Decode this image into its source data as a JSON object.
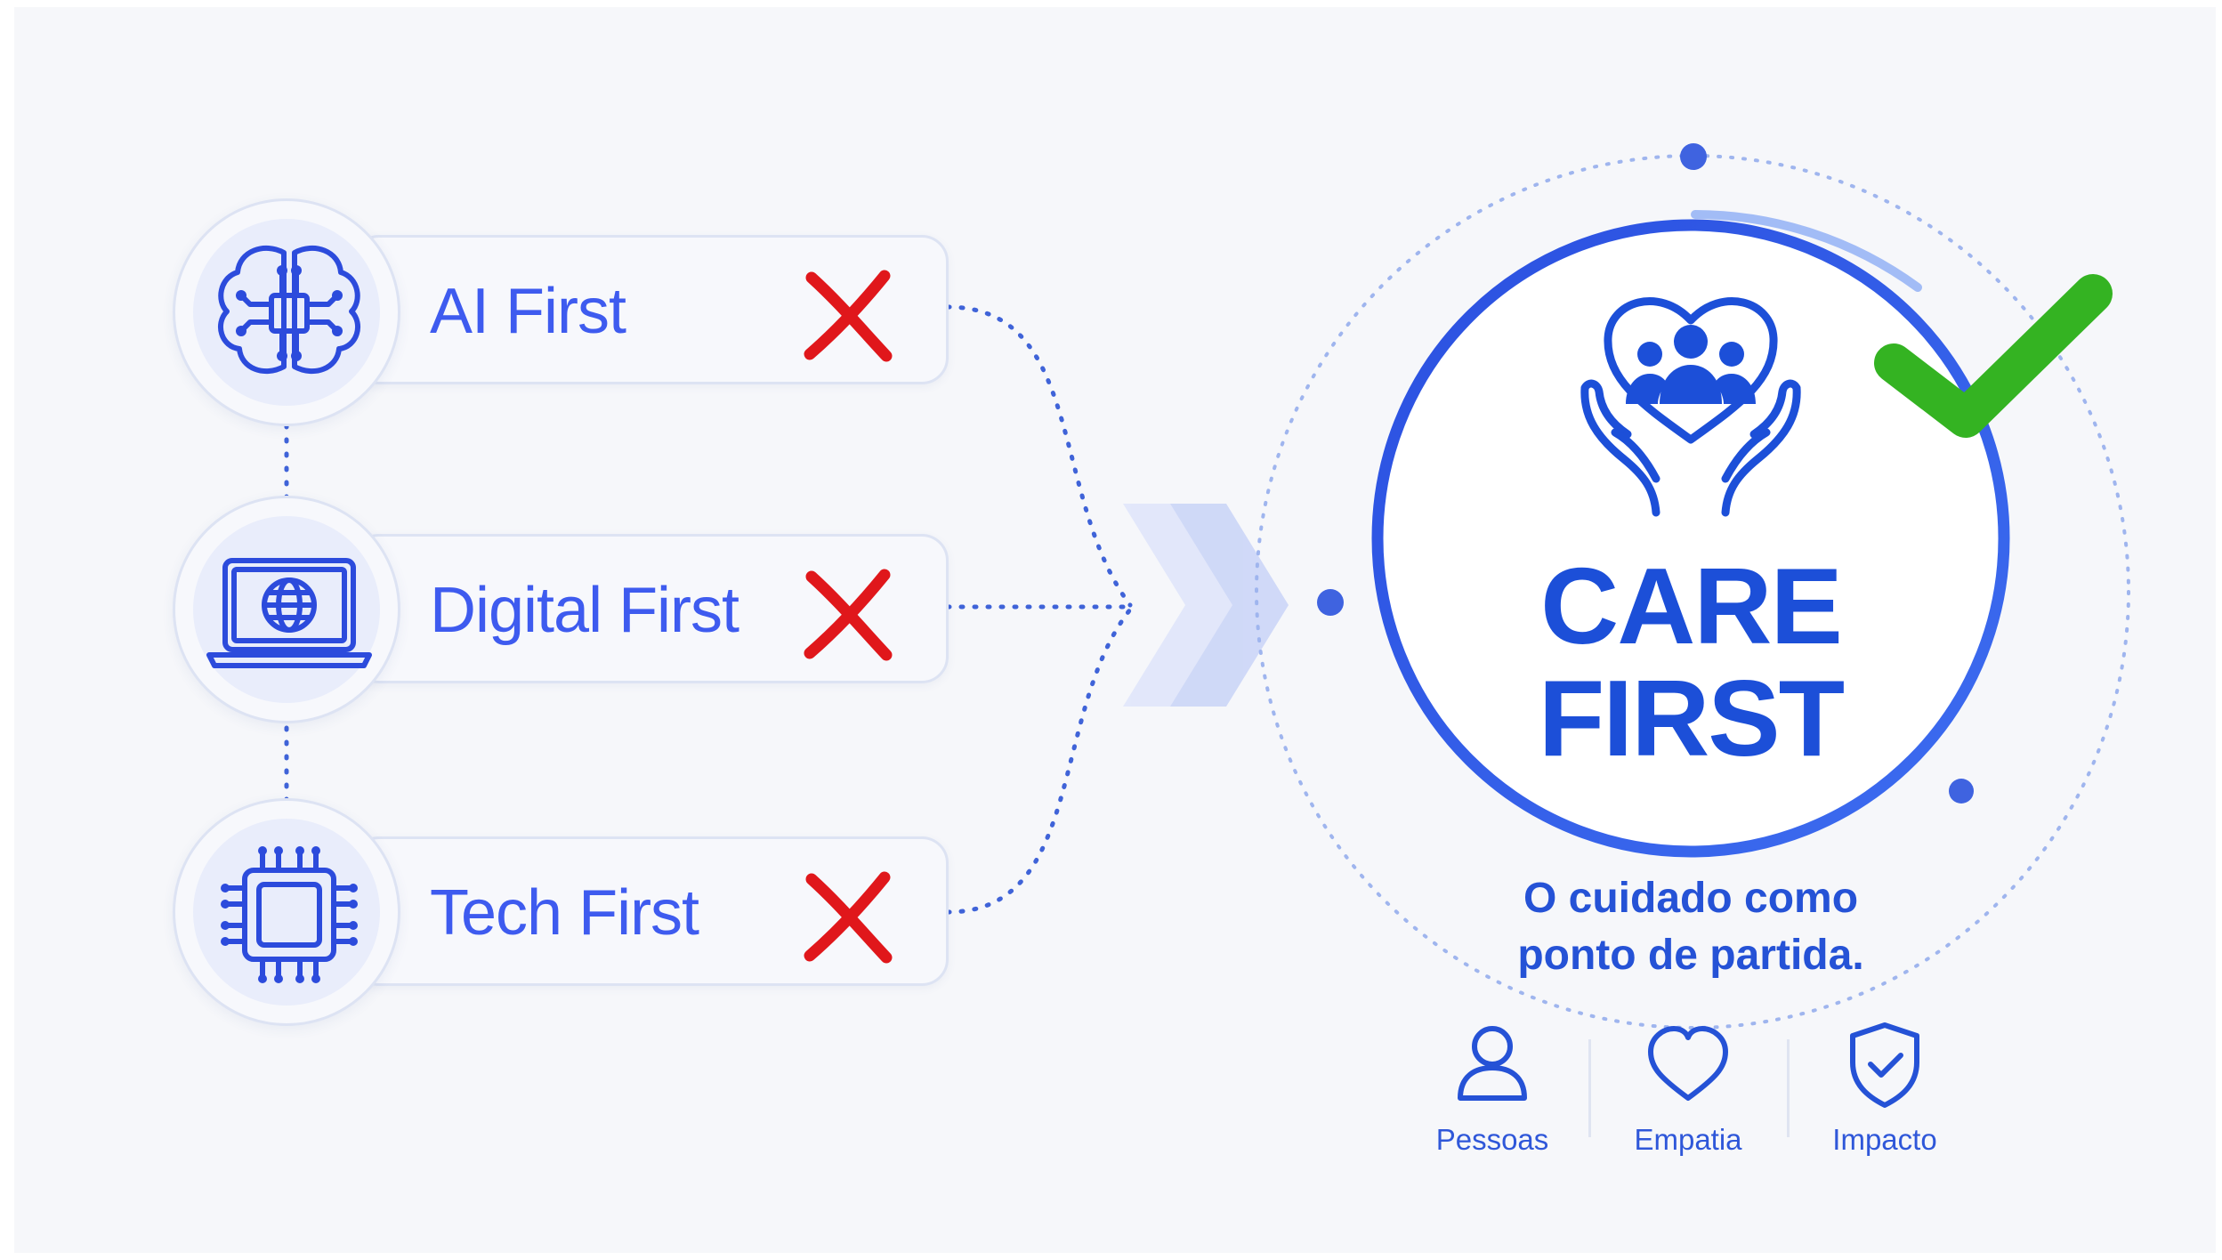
{
  "options": [
    {
      "label": "AI First",
      "icon": "brain-chip-icon",
      "status": "rejected"
    },
    {
      "label": "Digital First",
      "icon": "laptop-globe-icon",
      "status": "rejected"
    },
    {
      "label": "Tech First",
      "icon": "microchip-icon",
      "status": "rejected"
    }
  ],
  "result": {
    "title_line1": "CARE",
    "title_line2": "FIRST",
    "icon": "hands-heart-people-icon",
    "status": "approved",
    "tagline_line1": "O cuidado como",
    "tagline_line2": "ponto de partida."
  },
  "values": [
    {
      "label": "Pessoas",
      "icon": "person-icon"
    },
    {
      "label": "Empatia",
      "icon": "heart-icon"
    },
    {
      "label": "Impacto",
      "icon": "shield-check-icon"
    }
  ],
  "colors": {
    "primary": "#1c4fd8",
    "accent_blue": "#3e5bef",
    "reject_red": "#e0171b",
    "approve_green": "#34b322",
    "background": "#f6f7fa"
  }
}
